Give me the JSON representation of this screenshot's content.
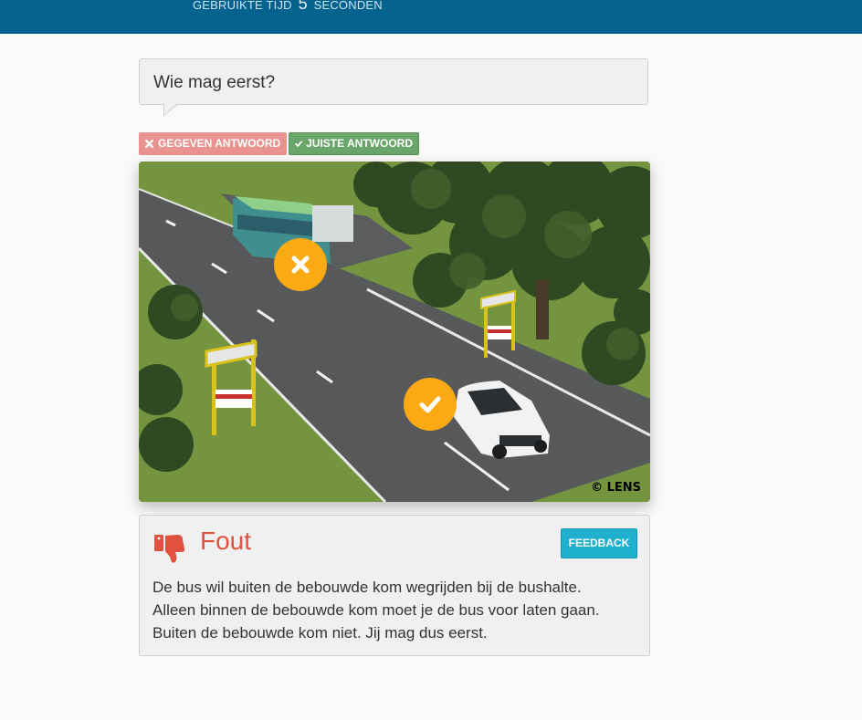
{
  "header": {
    "timer_prefix": "GEBRUIKTE TIJD",
    "timer_value": "5",
    "timer_suffix": "SECONDEN"
  },
  "question": {
    "text": "Wie mag eerst?"
  },
  "badges": {
    "given_label": "GEGEVEN ANTWOORD",
    "correct_label": "JUISTE ANTWOORD",
    "given_color": "#e8938f",
    "correct_color": "#6aa66a"
  },
  "image": {
    "copyright": "© LENS",
    "markers": [
      {
        "name": "bus",
        "status": "given-answer",
        "icon": "close-icon"
      },
      {
        "name": "car",
        "status": "correct-answer",
        "icon": "check-icon"
      }
    ],
    "marker_color": "#fcaa14"
  },
  "result": {
    "verdict": "Fout",
    "verdict_color": "#e0513f",
    "feedback_label": "FEEDBACK",
    "explanation_lines": [
      "De bus wil buiten de bebouwde kom wegrijden bij de bushalte.",
      "Alleen binnen de bebouwde kom moet je de bus voor laten gaan.",
      "Buiten de bebouwde kom niet. Jij mag dus eerst."
    ]
  }
}
